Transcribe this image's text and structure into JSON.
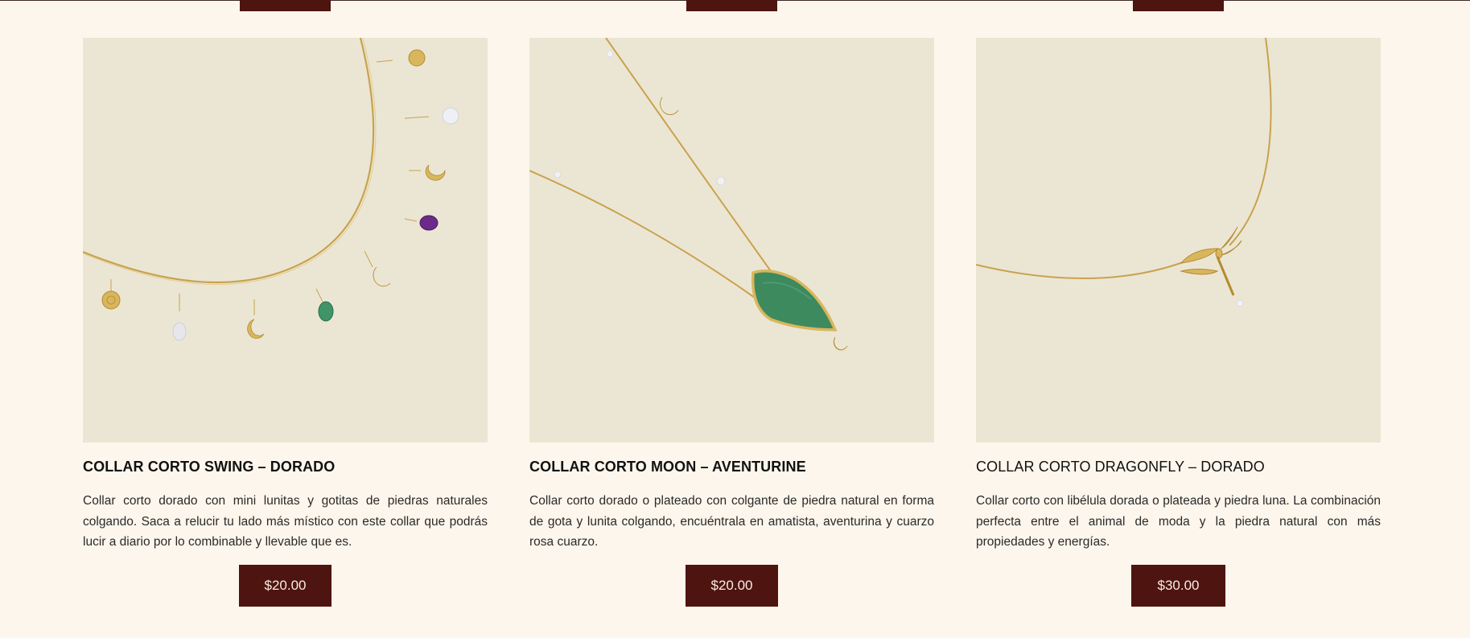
{
  "products": [
    {
      "title": "COLLAR CORTO SWING – DORADO",
      "description": "Collar corto dorado con mini lunitas y gotitas de piedras naturales colgando. Saca a relucir tu lado más místico con este collar que podrás lucir a diario por lo combinable y llevable que es.",
      "price": "$20.00",
      "image_alt": "Gold necklace with moon charms and natural stone drops"
    },
    {
      "title": "COLLAR CORTO MOON – AVENTURINE",
      "description": "Collar corto dorado o plateado con colgante de piedra natural en forma de gota y lunita colgando, encuéntrala en amatista, aventurina y cuarzo rosa cuarzo.",
      "price": "$20.00",
      "image_alt": "Gold necklace with green aventurine teardrop pendant"
    },
    {
      "title": "COLLAR CORTO DRAGONFLY – DORADO",
      "description": "Collar corto con libélula dorada o plateada y piedra luna. La combinación perfecta entre el animal de moda y la piedra natural con más propiedades y energías.",
      "price": "$30.00",
      "image_alt": "Gold necklace with dragonfly charm"
    }
  ],
  "colors": {
    "background": "#fdf6ec",
    "button": "#4e1410",
    "button_text": "#f8ece3",
    "image_bg": "#ebe6d3",
    "gold": "#c9a24e"
  }
}
